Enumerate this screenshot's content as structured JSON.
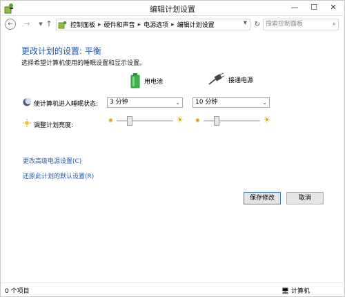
{
  "window": {
    "title": "编辑计划设置",
    "minimize": "—",
    "maximize": "☐",
    "close": "✕"
  },
  "address": {
    "breadcrumbs": [
      "控制面板",
      "硬件和声音",
      "电源选项",
      "编辑计划设置"
    ],
    "separator": "▸",
    "search_placeholder": "搜索控制面板"
  },
  "main": {
    "heading": "更改计划的设置: 平衡",
    "description": "选择希望计算机使用的睡眠设置和显示设置。",
    "battery_column": "用电池",
    "plugged_column": "接通电源",
    "sleep_label": "使计算机进入睡眠状态:",
    "sleep_battery_value": "3 分钟",
    "sleep_plugged_value": "10 分钟",
    "brightness_label": "调整计划亮度:",
    "brightness_battery_level": 0.2,
    "brightness_plugged_level": 0.2,
    "advanced_link": "更改高级电源设置(C)",
    "restore_link": "还原此计划的默认设置(R)",
    "save_button": "保存修改",
    "cancel_button": "取消"
  },
  "status": {
    "items_count": "0 个项目",
    "location": "计算机"
  },
  "colors": {
    "link": "#1e5aa8",
    "battery_green": "#3ab54a",
    "plug_gray": "#555555"
  }
}
